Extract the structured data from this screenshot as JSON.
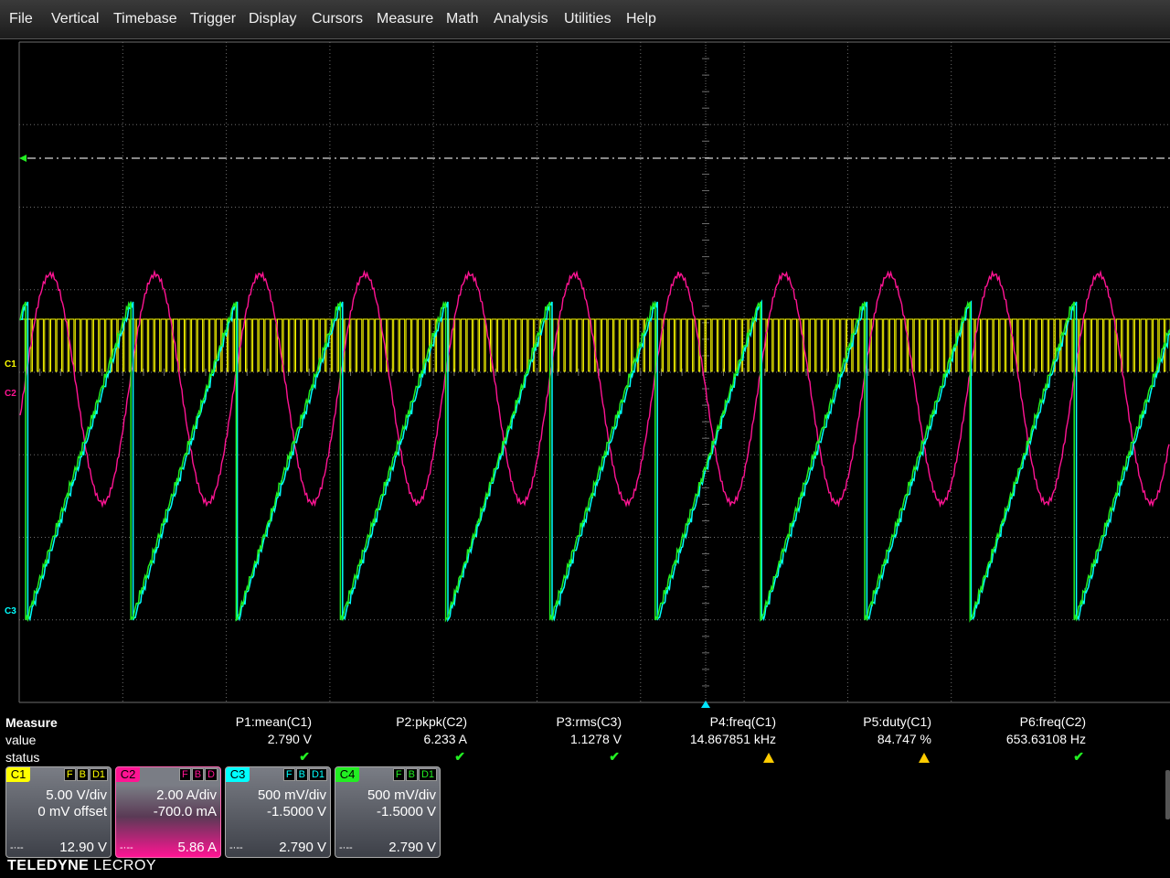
{
  "menu": [
    "File",
    "Vertical",
    "Timebase",
    "Trigger",
    "Display",
    "Cursors",
    "Measure",
    "Math",
    "Analysis",
    "Utilities",
    "Help"
  ],
  "channel_markers": {
    "c1": "C1",
    "c2": "C2",
    "c3": "C3"
  },
  "colors": {
    "c1": "#ffff00",
    "c2": "#ff1493",
    "c3": "#00ffff",
    "c4": "#22ee22",
    "grid": "#6e6e6e",
    "trigger_level": "#d8d8d8"
  },
  "measure": {
    "title": "Measure",
    "row_value": "value",
    "row_status": "status",
    "params": [
      {
        "name": "P1:mean(C1)",
        "value": "2.790 V",
        "status": "ok"
      },
      {
        "name": "P2:pkpk(C2)",
        "value": "6.233 A",
        "status": "ok"
      },
      {
        "name": "P3:rms(C3)",
        "value": "1.1278 V",
        "status": "ok"
      },
      {
        "name": "P4:freq(C1)",
        "value": "14.867851 kHz",
        "status": "warning"
      },
      {
        "name": "P5:duty(C1)",
        "value": "84.747 %",
        "status": "warning"
      },
      {
        "name": "P6:freq(C2)",
        "value": "653.63108 Hz",
        "status": "ok"
      }
    ]
  },
  "channels": [
    {
      "name": "C1",
      "flags": [
        "F",
        "B",
        "D1"
      ],
      "scale": "5.00 V/div",
      "offset": "0 mV offset",
      "coupling": "-·--",
      "bottom": "12.90 V"
    },
    {
      "name": "C2",
      "flags": [
        "F",
        "B",
        "D"
      ],
      "scale": "2.00 A/div",
      "offset": "-700.0 mA",
      "coupling": "-·--",
      "bottom": "5.86 A"
    },
    {
      "name": "C3",
      "flags": [
        "F",
        "B",
        "D1"
      ],
      "scale": "500 mV/div",
      "offset": "-1.5000 V",
      "coupling": "-·--",
      "bottom": "2.790 V"
    },
    {
      "name": "C4",
      "flags": [
        "F",
        "B",
        "D1"
      ],
      "scale": "500 mV/div",
      "offset": "-1.5000 V",
      "coupling": "-·--",
      "bottom": "2.790 V"
    }
  ],
  "brand": {
    "strong": "TELEDYNE",
    "light": " LECROY"
  }
}
